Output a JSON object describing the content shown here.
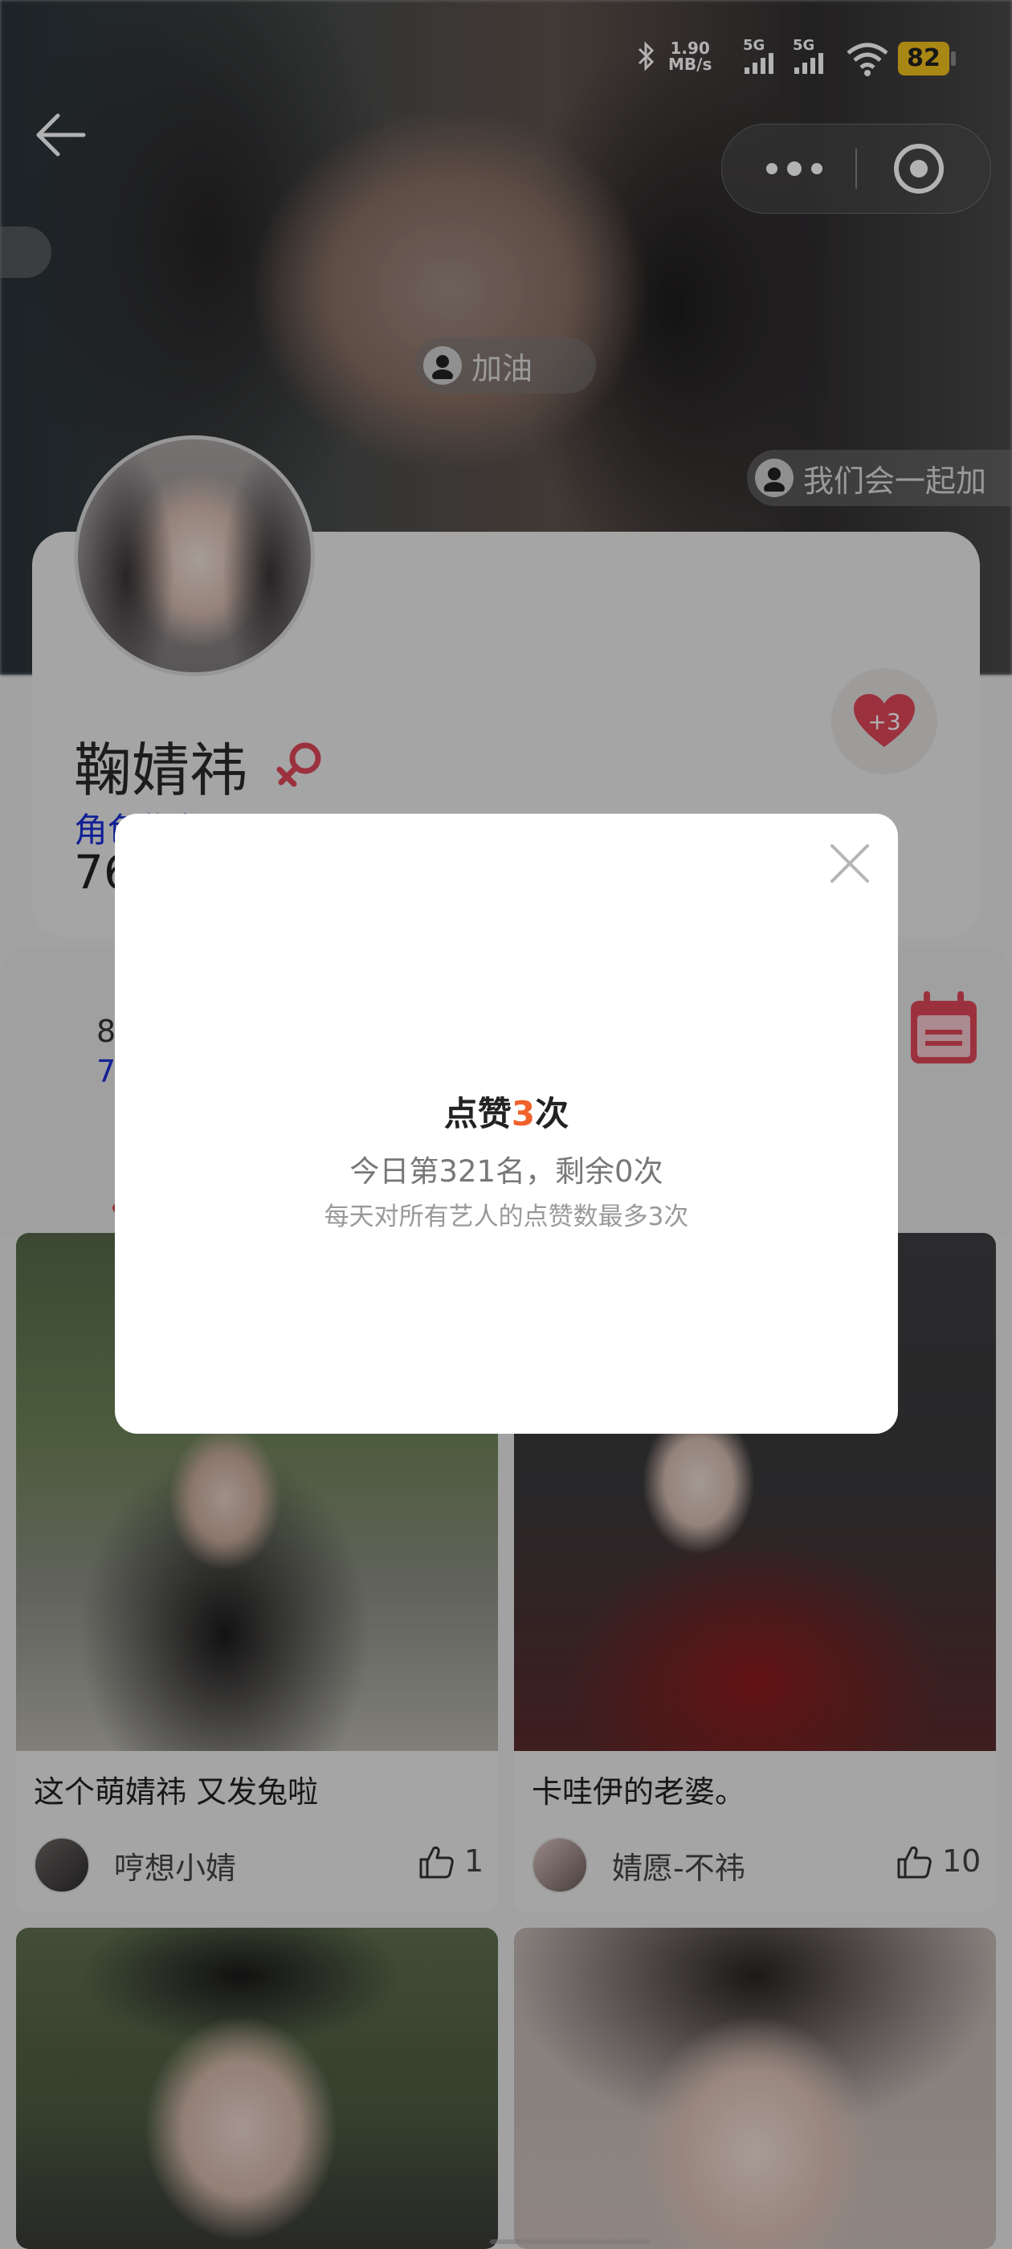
{
  "status_bar": {
    "net_speed_value": "1.90",
    "net_speed_unit": "MB/s",
    "sim1": "5G",
    "sim2": "5G",
    "battery": "82"
  },
  "hero": {
    "cheer_tag": "加油",
    "comment_tag": "我们会一起加"
  },
  "profile": {
    "name": "鞠婧祎",
    "index_label": "角色指数：7.17",
    "number_partial": "76",
    "heart_badge": "+3"
  },
  "stats_partial": {
    "value_a": "8",
    "value_b": "7"
  },
  "posts": [
    {
      "title": "这个萌婧祎 又发兔啦",
      "author": "哼想小婧",
      "likes": "1"
    },
    {
      "title": "卡哇伊的老婆。",
      "author": "婧愿-不祎",
      "likes": "10"
    }
  ],
  "dialog": {
    "title_prefix": "点赞",
    "title_count": "3",
    "title_suffix": "次",
    "rank_text": "今日第321名，剩余0次",
    "note": "每天对所有艺人的点赞数最多3次"
  },
  "colors": {
    "accent_orange": "#f0612b",
    "heart_red": "#e0475a",
    "index_blue": "#1a2fd6"
  }
}
